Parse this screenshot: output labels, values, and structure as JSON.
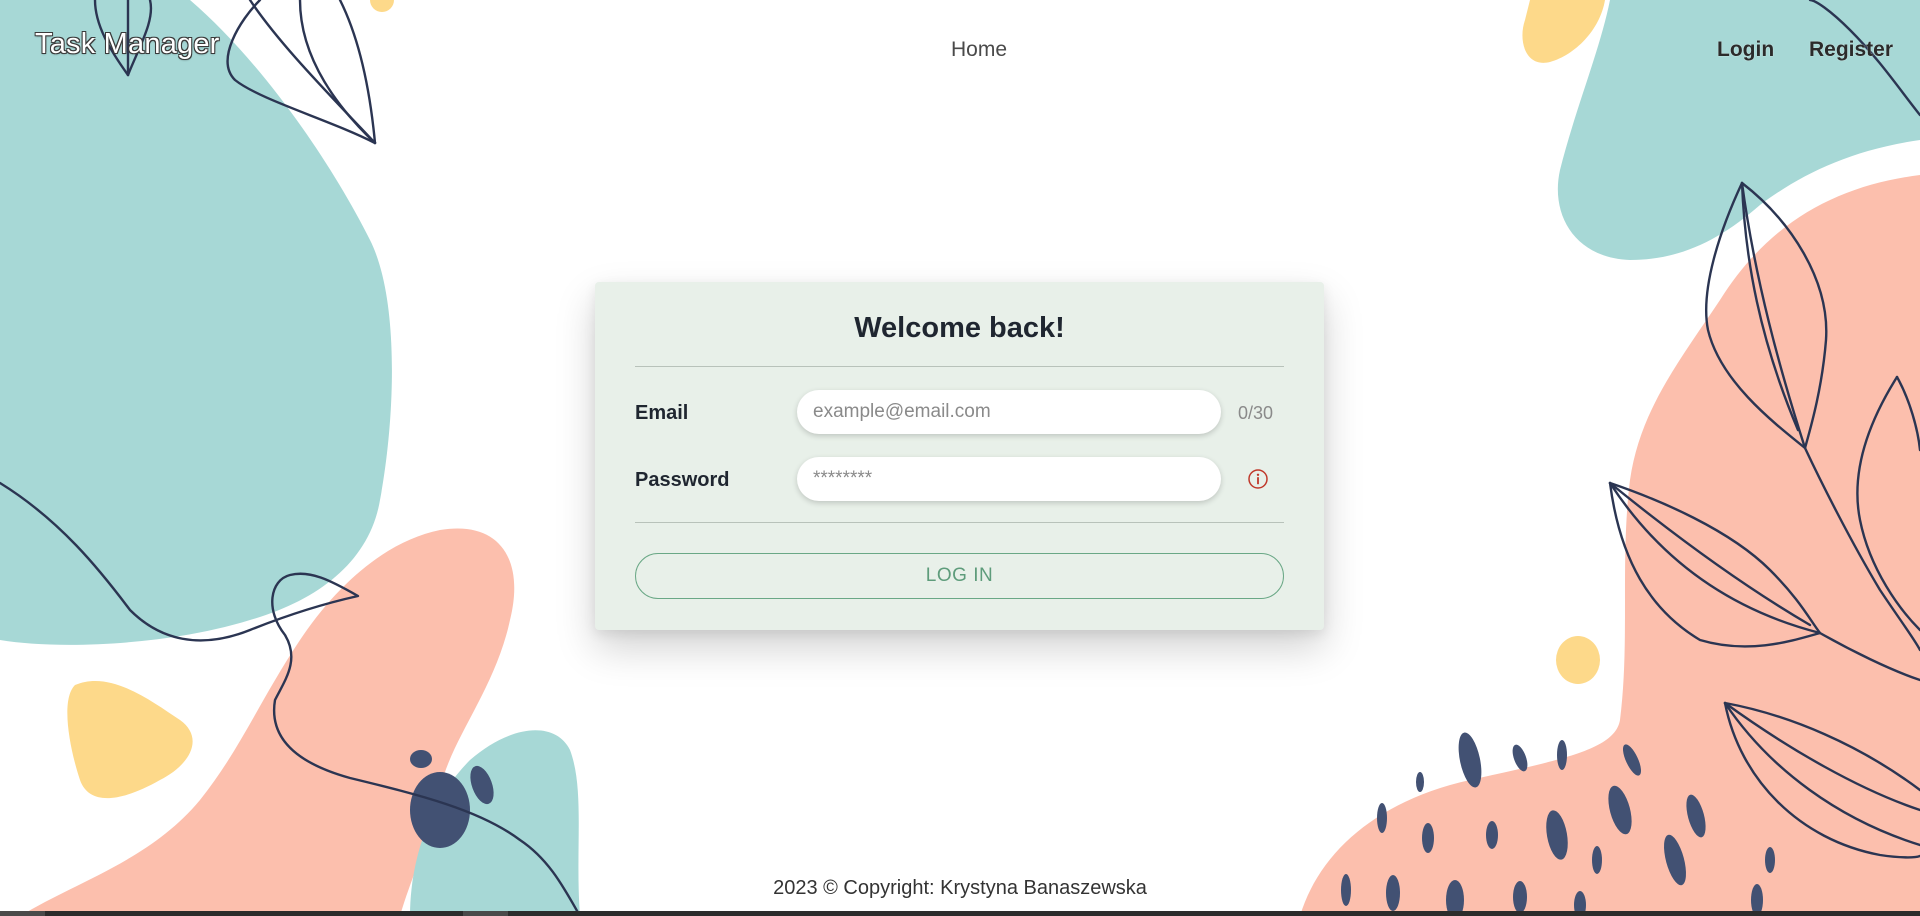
{
  "nav": {
    "brand": "Task Manager",
    "home": "Home",
    "login": "Login",
    "register": "Register"
  },
  "login_card": {
    "title": "Welcome back!",
    "email_label": "Email",
    "email_placeholder": "example@email.com",
    "email_counter": "0/30",
    "password_label": "Password",
    "password_placeholder": "********",
    "password_info_icon": "info-circle-icon",
    "submit_label": "LOG IN"
  },
  "footer": {
    "copyright": "2023 © Copyright: Krystyna Banaszewska"
  },
  "colors": {
    "card_bg": "#e8f0e9",
    "accent_green": "#5e9c7b",
    "teal": "#a7d8d6",
    "salmon": "#fcbfad",
    "yellow": "#fdd98a",
    "navy": "#425173",
    "error_red": "#c0392b"
  }
}
